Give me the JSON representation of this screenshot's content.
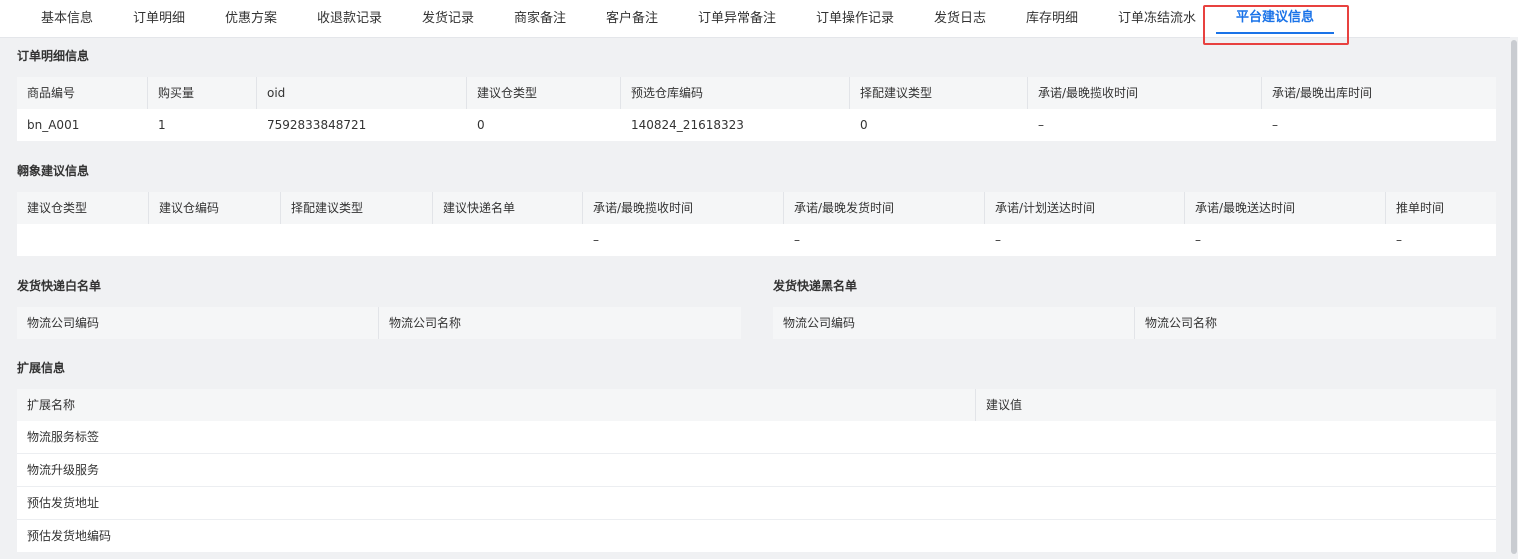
{
  "tabs": [
    {
      "label": "基本信息",
      "active": false
    },
    {
      "label": "订单明细",
      "active": false
    },
    {
      "label": "优惠方案",
      "active": false
    },
    {
      "label": "收退款记录",
      "active": false
    },
    {
      "label": "发货记录",
      "active": false
    },
    {
      "label": "商家备注",
      "active": false
    },
    {
      "label": "客户备注",
      "active": false
    },
    {
      "label": "订单异常备注",
      "active": false
    },
    {
      "label": "订单操作记录",
      "active": false
    },
    {
      "label": "发货日志",
      "active": false
    },
    {
      "label": "库存明细",
      "active": false
    },
    {
      "label": "订单冻结流水",
      "active": false
    },
    {
      "label": "平台建议信息",
      "active": true
    }
  ],
  "accent_color": "#1a73e8",
  "highlight_color": "#e8413f",
  "order_detail": {
    "title": "订单明细信息",
    "columns": [
      "商品编号",
      "购买量",
      "oid",
      "建议仓类型",
      "预选仓库编码",
      "择配建议类型",
      "承诺/最晚揽收时间",
      "承诺/最晚出库时间"
    ],
    "rows": [
      [
        "bn_A001",
        "1",
        "7592833848721",
        "0",
        "140824_21618323",
        "0",
        "–",
        "–"
      ]
    ]
  },
  "suggestion": {
    "title": "翱象建议信息",
    "columns": [
      "建议仓类型",
      "建议仓编码",
      "择配建议类型",
      "建议快递名单",
      "承诺/最晚揽收时间",
      "承诺/最晚发货时间",
      "承诺/计划送达时间",
      "承诺/最晚送达时间",
      "推单时间"
    ],
    "rows": [
      [
        "",
        "",
        "",
        "",
        "–",
        "–",
        "–",
        "–",
        "–"
      ]
    ]
  },
  "whitelist": {
    "title": "发货快递白名单",
    "columns": [
      "物流公司编码",
      "物流公司名称"
    ]
  },
  "blacklist": {
    "title": "发货快递黑名单",
    "columns": [
      "物流公司编码",
      "物流公司名称"
    ]
  },
  "extension": {
    "title": "扩展信息",
    "columns": [
      "扩展名称",
      "建议值"
    ],
    "rows": [
      [
        "物流服务标签",
        ""
      ],
      [
        "物流升级服务",
        ""
      ],
      [
        "预估发货地址",
        ""
      ],
      [
        "预估发货地编码",
        ""
      ]
    ]
  }
}
